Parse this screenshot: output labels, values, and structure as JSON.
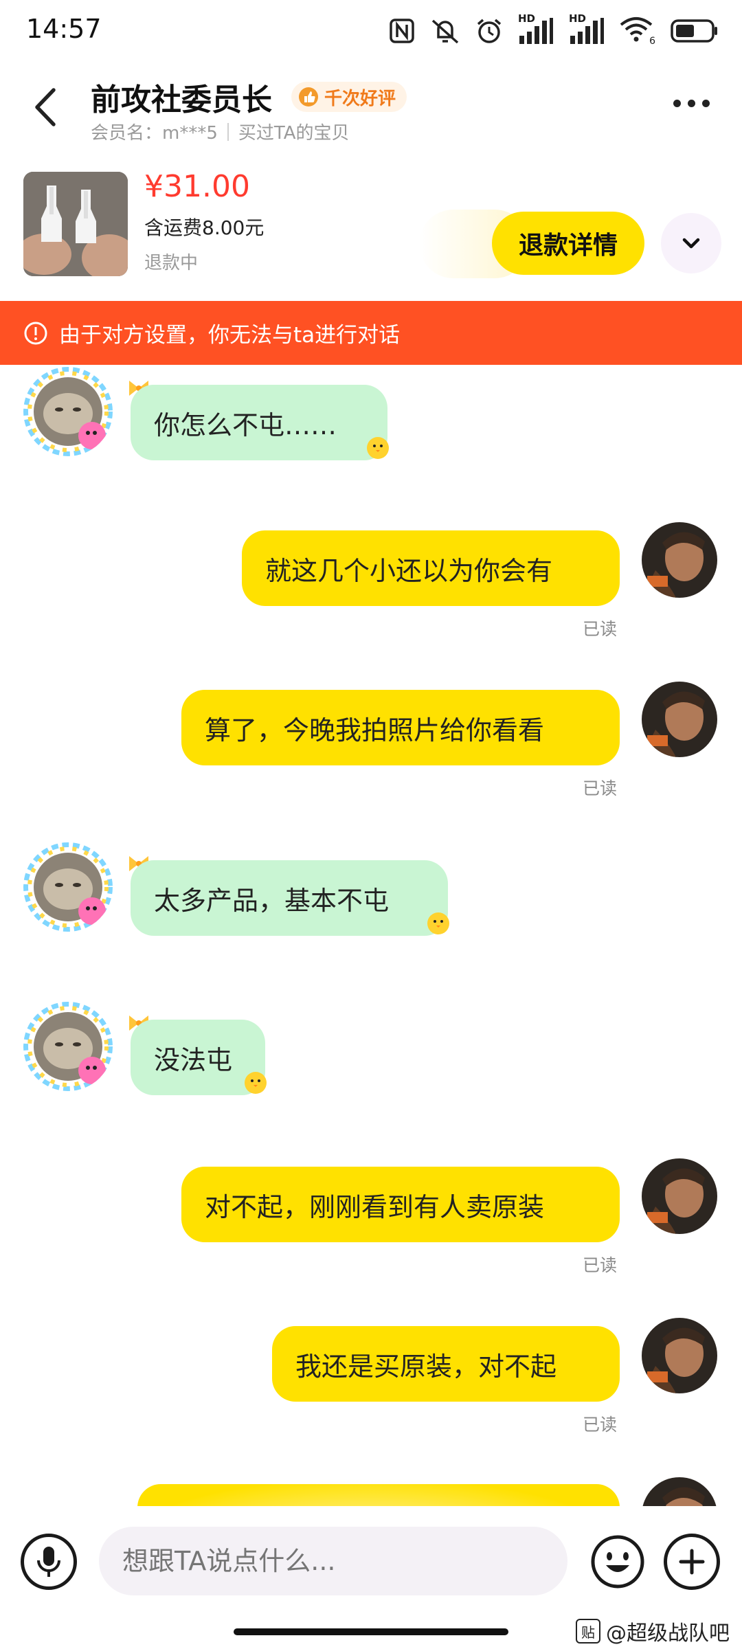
{
  "status_bar": {
    "time": "14:57",
    "hd1": "HD",
    "hd2": "HD",
    "wifi_sub": "6",
    "icons": [
      "nfc-icon",
      "mute-vibrate-icon",
      "alarm-icon",
      "signal-icon",
      "signal-icon",
      "wifi-icon",
      "battery-icon"
    ]
  },
  "header": {
    "title": "前攻社委员长",
    "badge": "千次好评",
    "member_label": "会员名：m***5",
    "bought_label": "买过TA的宝贝"
  },
  "product": {
    "price": "¥31.00",
    "shipping": "含运费8.00元",
    "status": "退款中",
    "refund_button": "退款详情"
  },
  "banner": {
    "text": "由于对方设置，你无法与ta进行对话"
  },
  "messages": [
    {
      "side": "in",
      "text": "你怎么不屯……"
    },
    {
      "side": "out",
      "text": "就这几个小还以为你会有",
      "read": "已读"
    },
    {
      "side": "out",
      "text": "算了，今晚我拍照片给你看看",
      "read": "已读"
    },
    {
      "side": "in",
      "text": "太多产品，基本不屯"
    },
    {
      "side": "in",
      "text": "没法屯"
    },
    {
      "side": "out",
      "text": "对不起，刚刚看到有人卖原装",
      "read": "已读"
    },
    {
      "side": "out",
      "text": "我还是买原装，对不起",
      "read": "已读"
    }
  ],
  "input": {
    "placeholder": "想跟TA说点什么..."
  },
  "watermark": {
    "logo": "贴",
    "text": "@超级战队吧"
  },
  "colors": {
    "accent_yellow": "#ffe100",
    "incoming_bubble": "#c9f5d3",
    "banner_red": "#ff5123",
    "price_red": "#ff3b2f"
  }
}
